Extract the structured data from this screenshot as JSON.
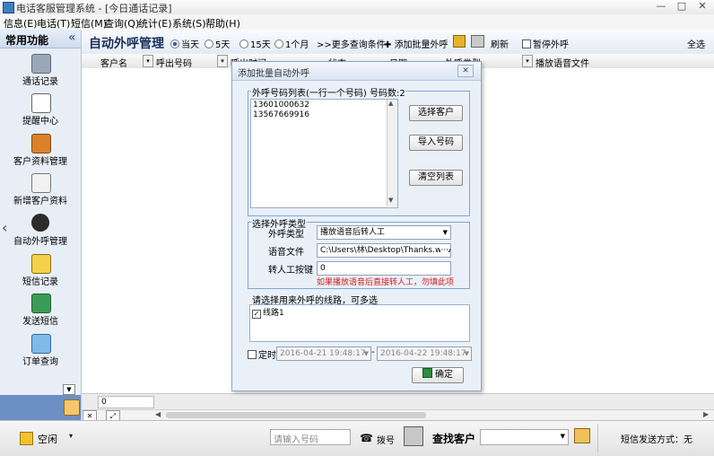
{
  "window": {
    "title": "电话客服管理系统 - [今日通话记录]"
  },
  "menu": [
    "信息(E)",
    "电话(T)",
    "短信(M)",
    "查询(Q)",
    "统计(E)",
    "系统(S)",
    "帮助(H)"
  ],
  "sidebar": {
    "header": "常用功能",
    "collapse": "«",
    "items": [
      {
        "label": "通话记录",
        "icon": "phone-icon"
      },
      {
        "label": "提醒中心",
        "icon": "reminder-icon"
      },
      {
        "label": "客户资料管理",
        "icon": "customers-icon"
      },
      {
        "label": "新增客户资料",
        "icon": "add-customer-icon"
      },
      {
        "label": "自动外呼管理",
        "icon": "auto-dial-icon"
      },
      {
        "label": "短信记录",
        "icon": "sms-icon"
      },
      {
        "label": "发送短信",
        "icon": "send-sms-icon"
      },
      {
        "label": "订单查询",
        "icon": "order-search-icon"
      }
    ]
  },
  "main": {
    "title": "自动外呼管理",
    "ranges": [
      "当天",
      "5天",
      "15天",
      "1个月"
    ],
    "more": ">>更多查询条件",
    "add_batch": "添加批量外呼",
    "refresh": "刷新",
    "pause": "暂停外呼",
    "select_all": "全选",
    "columns": [
      "客户名",
      "呼出号码",
      "呼出时间",
      "状态",
      "日期",
      "外呼类型",
      "播放语音文件"
    ],
    "footer_count": "0"
  },
  "dialog": {
    "title": "添加批量自动外呼",
    "numbers_group": "外呼号码列表(一行一个号码) 号码数:2",
    "numbers": [
      "13601000632",
      "13567669916"
    ],
    "btn_select": "选择客户",
    "btn_import": "导入号码",
    "btn_clear": "清空列表",
    "type_group": "选择外呼类型",
    "type_label": "外呼类型",
    "type_value": "播放语音后转人工",
    "voice_label": "语音文件",
    "voice_value": "C:\\Users\\林\\Desktop\\Thanks.wav",
    "key_label": "转人工按键",
    "key_value": "0",
    "hint": "如果播放语音后直接转人工，勿填此项",
    "lines_label": "请选择用来外呼的线路，可多选",
    "line1": "线路1",
    "timer_label": "定时",
    "date_from": "2016-04-21 19:48:17",
    "date_to": "2016-04-22 19:48:17",
    "confirm": "确定"
  },
  "status": {
    "state": "空闲",
    "phone_placeholder": "请输入号码",
    "dial": "拨号",
    "find": "查找客户",
    "sms_mode": "短信发送方式：无"
  },
  "colors": {
    "accent": "#2a62b6",
    "hint": "#d41c1c",
    "group_border": "#7fa7d6"
  }
}
